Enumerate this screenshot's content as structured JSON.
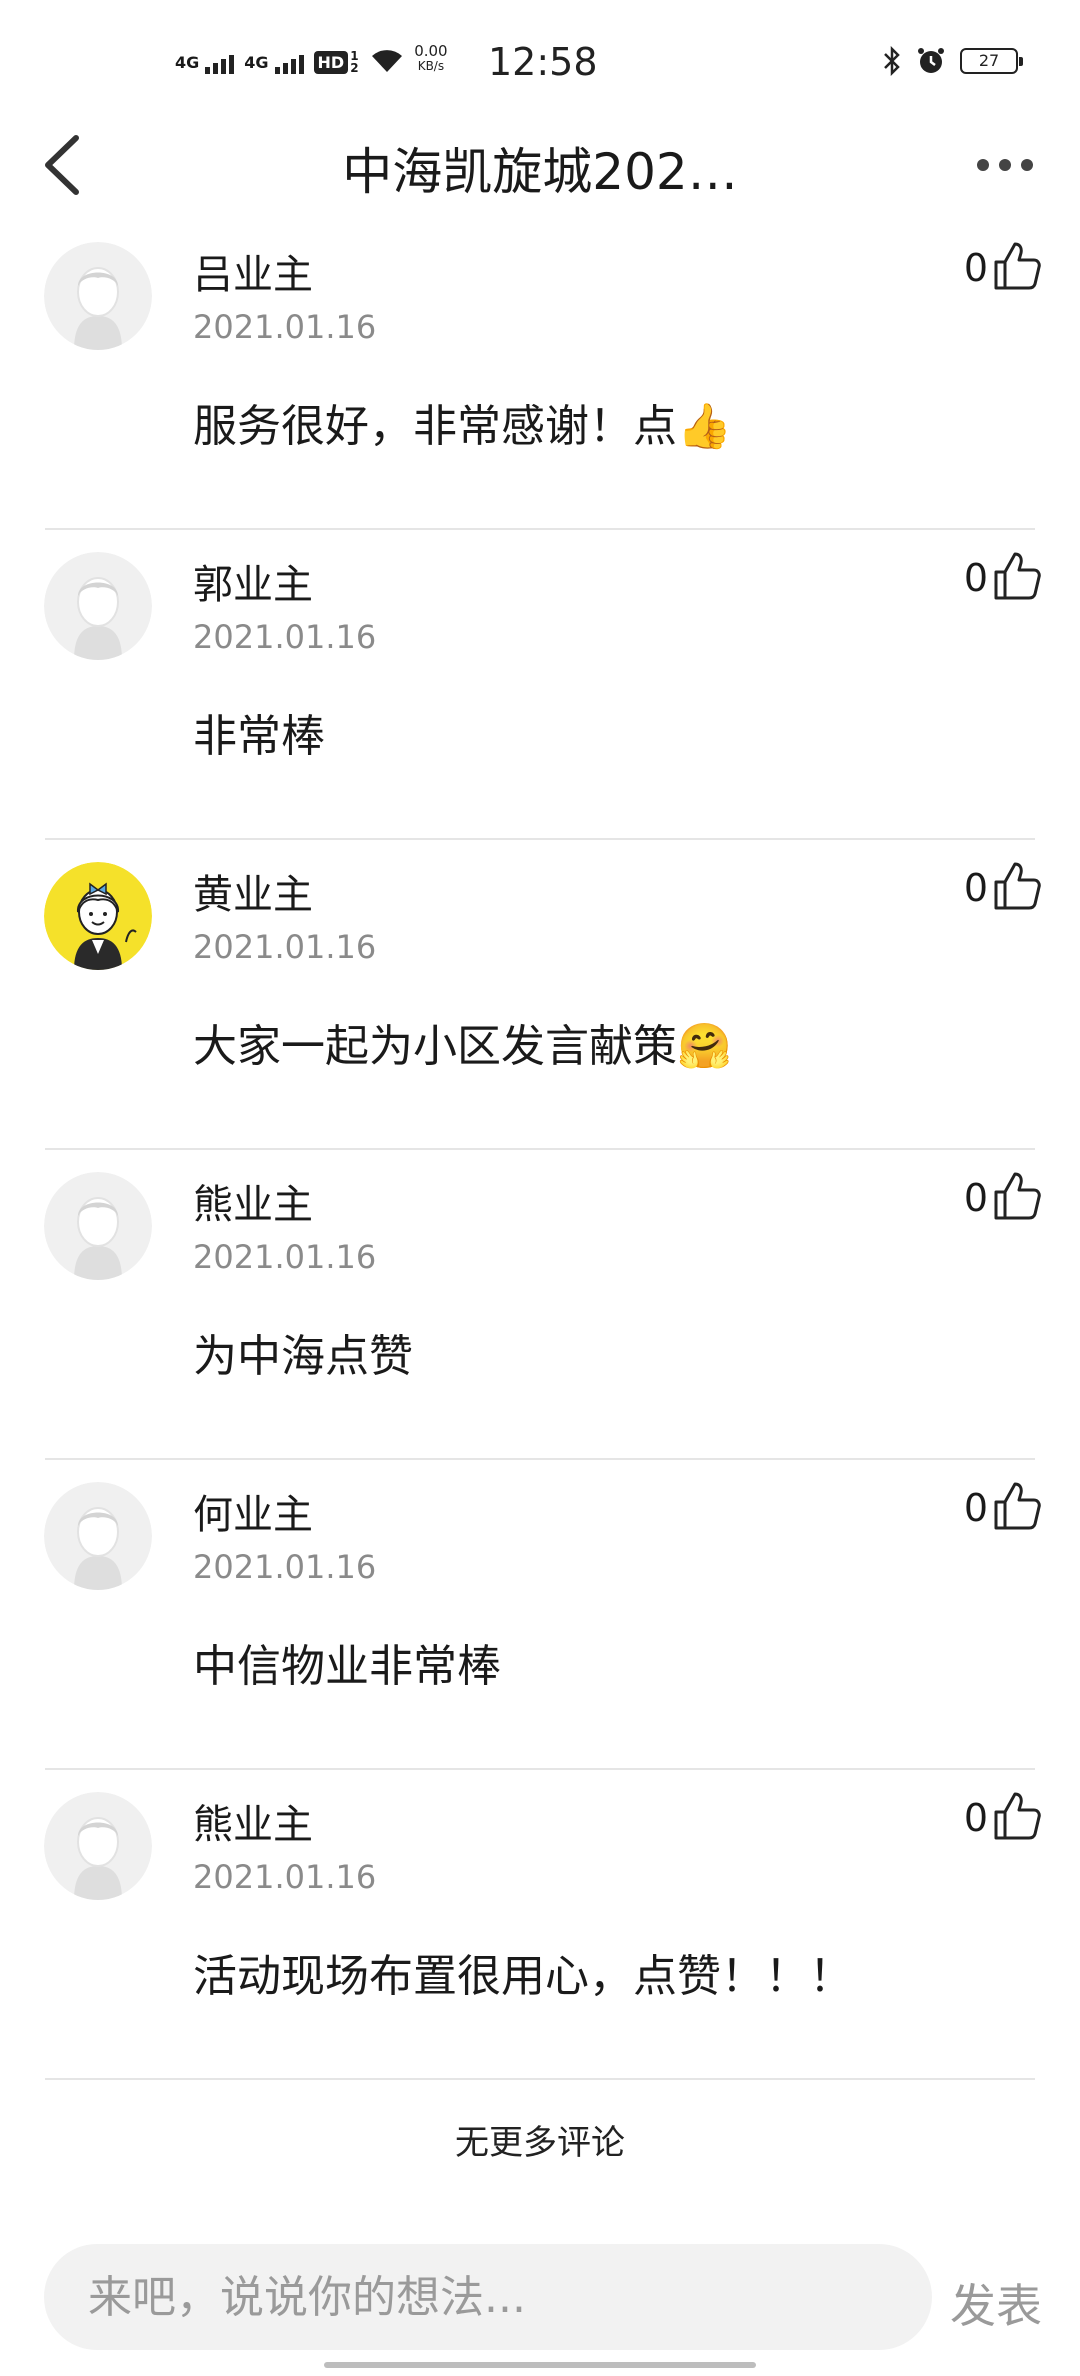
{
  "status_bar": {
    "sim1": "4G",
    "sim2": "4G",
    "hd_label": "HD",
    "hd_sub": "1 2",
    "speed_value": "0.00",
    "speed_unit": "KB/s",
    "time": "12:58",
    "battery": "27"
  },
  "header": {
    "title": "中海凯旋城202…",
    "back_icon": "chevron-left-icon",
    "more_icon": "more-horizontal-icon"
  },
  "comments": [
    {
      "name": "吕业主",
      "date": "2021.01.16",
      "text": "服务很好，非常感谢！点👍",
      "likes": "0",
      "avatar": "default"
    },
    {
      "name": "郭业主",
      "date": "2021.01.16",
      "text": "非常棒",
      "likes": "0",
      "avatar": "default"
    },
    {
      "name": "黄业主",
      "date": "2021.01.16",
      "text": "大家一起为小区发言献策🤗",
      "likes": "0",
      "avatar": "cartoon-girl"
    },
    {
      "name": "熊业主",
      "date": "2021.01.16",
      "text": "为中海点赞",
      "likes": "0",
      "avatar": "default"
    },
    {
      "name": "何业主",
      "date": "2021.01.16",
      "text": "中信物业非常棒",
      "likes": "0",
      "avatar": "default"
    },
    {
      "name": "熊业主",
      "date": "2021.01.16",
      "text": "活动现场布置很用心，点赞！！！",
      "likes": "0",
      "avatar": "default"
    }
  ],
  "footer": {
    "no_more": "无更多评论",
    "input_placeholder": "来吧，说说你的想法...",
    "send_label": "发表"
  },
  "colors": {
    "divider": "#e5e5e5",
    "date_text": "#8a8a8a",
    "input_bg": "#f2f2f2",
    "send_text": "#9a9a9a",
    "avatar_yellow": "#f5e12a"
  }
}
